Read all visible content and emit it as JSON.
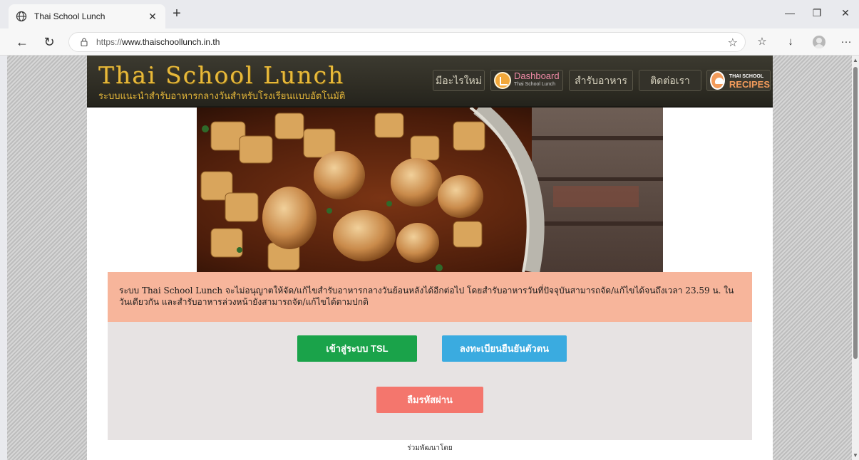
{
  "browser": {
    "tab_title": "Thai School Lunch",
    "url_protocol": "https://",
    "url_host": "www.thaischoollunch.in.th",
    "win_min": "—",
    "win_restore": "❐",
    "win_close": "✕"
  },
  "site": {
    "title": "Thai School Lunch",
    "subtitle": "ระบบแนะนำสำรับอาหารกลางวันสำหรับโรงเรียนแบบอัตโนมัติ",
    "nav": {
      "whats_new": "มีอะไรใหม่",
      "dashboard_main": "Dashboard",
      "dashboard_sub": "Thai School Lunch",
      "menus": "สำรับอาหาร",
      "contact": "ติดต่อเรา",
      "recipes_top": "THAI SCHOOL",
      "recipes_main": "RECIPES"
    },
    "notice": "ระบบ Thai School Lunch จะไม่อนุญาตให้จัด/แก้ไขสำรับอาหารกลางวันย้อนหลังได้อีกต่อไป โดยสำรับอาหารวันที่ปัจจุบันสามารถจัด/แก้ไขได้จนถึงเวลา 23.59 น. ในวันเดียวกัน และสำรับอาหารล่วงหน้ายังสามารถจัด/แก้ไขได้ตามปกติ",
    "buttons": {
      "login": "เข้าสู่ระบบ TSL",
      "register": "ลงทะเบียนยืนยันตัวตน",
      "forgot": "ลืมรหัสผ่าน"
    },
    "footer_note": "ร่วมพัฒนาโดย"
  },
  "colors": {
    "login": "#1aa34a",
    "register": "#3aabe0",
    "forgot": "#f4766d",
    "notice_bg": "#f7b59b",
    "title_gold": "#e8b93a"
  }
}
